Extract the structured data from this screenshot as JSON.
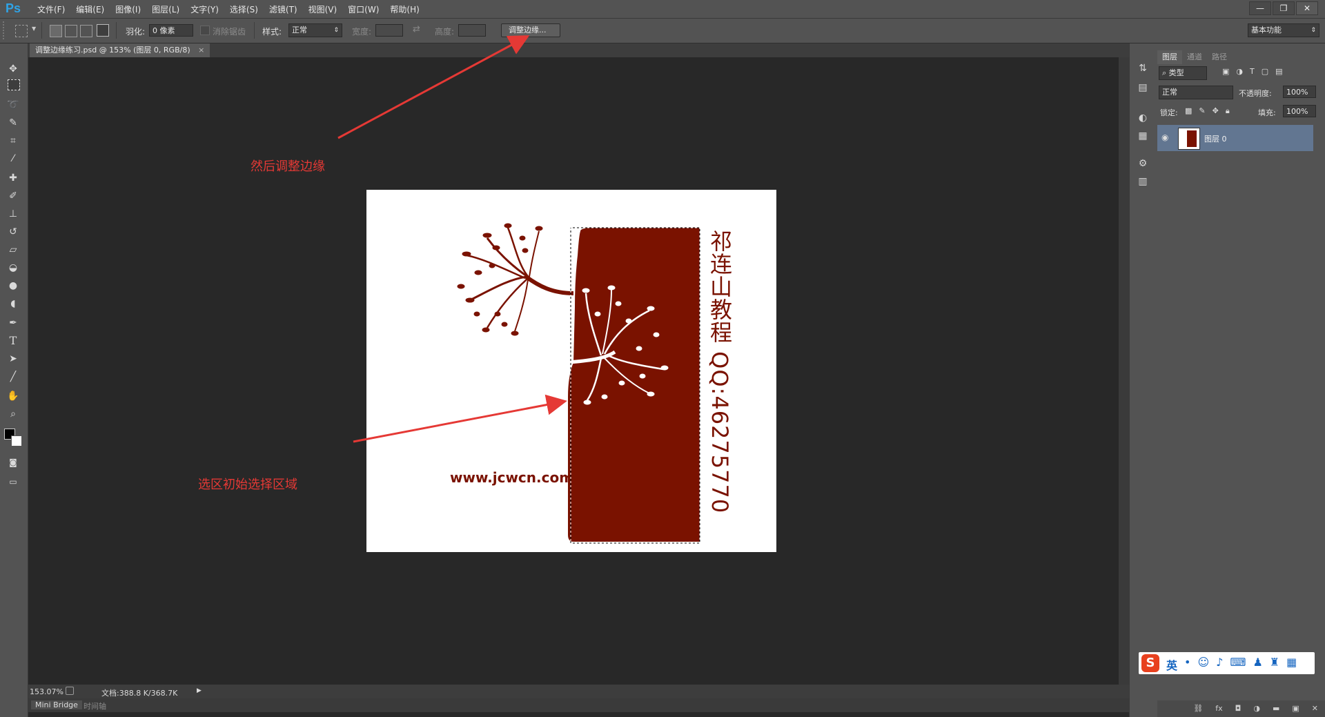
{
  "app": {
    "logo": "Ps"
  },
  "menu": [
    "文件(F)",
    "编辑(E)",
    "图像(I)",
    "图层(L)",
    "文字(Y)",
    "选择(S)",
    "滤镜(T)",
    "视图(V)",
    "窗口(W)",
    "帮助(H)"
  ],
  "window_controls": [
    "—",
    "❐",
    "✕"
  ],
  "options": {
    "feather_label": "羽化:",
    "feather_value": "0 像素",
    "antialias_label": "消除锯齿",
    "style_label": "样式:",
    "style_value": "正常",
    "width_label": "宽度:",
    "height_label": "高度:",
    "refine_edge_button": "调整边缘...",
    "workspace_value": "基本功能"
  },
  "document": {
    "tab_title": "调整边缘练习.psd @ 153% (图层 0, RGB/8)",
    "zoom": "153.07%",
    "doc_size": "文档:388.8 K/368.7K"
  },
  "bottom_tabs": [
    "Mini Bridge",
    "时间轴"
  ],
  "canvas": {
    "vertical_text": "祁连山教程 QQ:46275770",
    "url_text": "www.jcwcn.com",
    "brand_color": "#7a1200"
  },
  "annotations": {
    "top": "然后调整边缘",
    "bottom": "选区初始选择区域",
    "color": "#e53935"
  },
  "layers_panel": {
    "tabs": [
      "图层",
      "通道",
      "路径"
    ],
    "filter_kind": "类型",
    "blend_mode": "正常",
    "opacity_label": "不透明度:",
    "opacity_value": "100%",
    "lock_label": "锁定:",
    "fill_label": "填充:",
    "fill_value": "100%",
    "layers": [
      {
        "name": "图层 0",
        "visible": true
      }
    ]
  },
  "ime": {
    "lang": "英"
  }
}
